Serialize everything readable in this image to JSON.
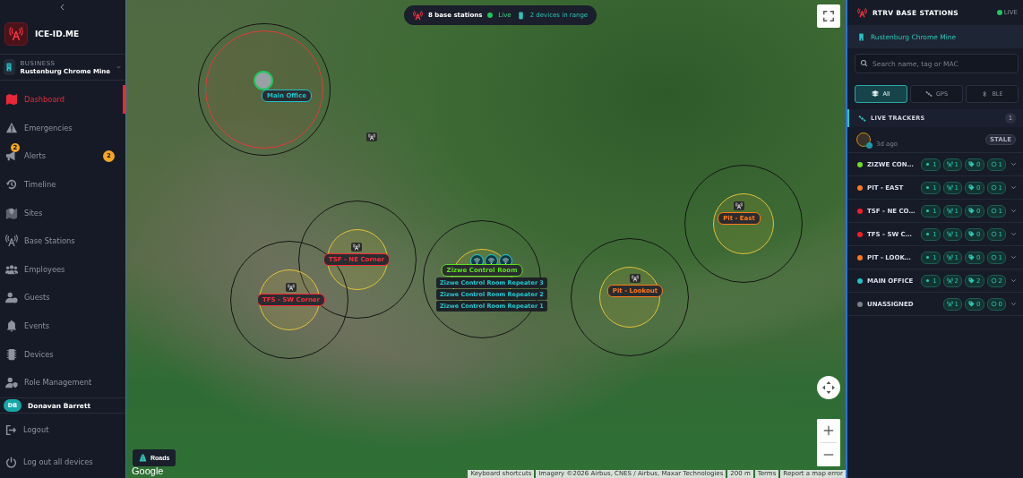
{
  "sidebar": {
    "brand": "ICE-ID.ME",
    "business": {
      "label": "BUSINESS",
      "name": "Rustenburg Chrome Mine"
    },
    "nav": [
      {
        "label": "Dashboard",
        "selected": true
      },
      {
        "label": "Emergencies",
        "selected": false
      },
      {
        "label": "Alerts",
        "selected": false,
        "icon_badge": "2",
        "badge": "2"
      },
      {
        "label": "Timeline",
        "selected": false
      },
      {
        "label": "Sites",
        "selected": false
      },
      {
        "label": "Base Stations",
        "selected": false
      },
      {
        "label": "Employees",
        "selected": false
      },
      {
        "label": "Guests",
        "selected": false
      },
      {
        "label": "Events",
        "selected": false
      },
      {
        "label": "Devices",
        "selected": false
      },
      {
        "label": "Role Management",
        "selected": false
      }
    ],
    "user": {
      "initials": "DB",
      "name": "Donavan Barrett"
    },
    "actions": [
      {
        "label": "Logout"
      },
      {
        "label": "Log out all devices"
      }
    ]
  },
  "map": {
    "status": {
      "stations": "8 base stations",
      "live": "Live",
      "devices": "2 devices in range"
    },
    "stations": [
      {
        "name": "Main Office",
        "color": "#1fc3c9"
      },
      {
        "name": "TSF - NE Corner",
        "color": "#ff2b3a"
      },
      {
        "name": "TFS - SW Corner",
        "color": "#ff2b3a"
      },
      {
        "name": "Zizwe Control Room",
        "color": "#5fe01f"
      },
      {
        "name": "Pit - Lookout",
        "color": "#ff7a1a"
      },
      {
        "name": "Pit - East",
        "color": "#ff7a1a"
      }
    ],
    "repeaters": [
      "Zizwe Control Room Repeater 3",
      "Zizwe Control Room Repeater 2",
      "Zizwe Control Room Repeater 1"
    ],
    "layer_button": "Roads",
    "logo": "Google",
    "attribution": [
      "Keyboard shortcuts",
      "Imagery ©2026 Airbus, CNES / Airbus, Maxar Technologies",
      "200 m",
      "Terms",
      "Report a map error"
    ]
  },
  "panel": {
    "title": "RTRV BASE STATIONS",
    "live": "LIVE",
    "site": "Rustenburg Chrome Mine",
    "search": {
      "placeholder": "Search name, tag or MAC"
    },
    "filters": [
      {
        "label": "All",
        "selected": true
      },
      {
        "label": "GPS",
        "selected": false
      },
      {
        "label": "BLE",
        "selected": false
      }
    ],
    "live_trackers": {
      "title": "LIVE TRACKERS",
      "count": "1",
      "trackers": [
        {
          "time": "3d ago",
          "status": "STALE"
        }
      ]
    },
    "sites": [
      {
        "name": "ZIZWE CON…",
        "color": "#6fe01f",
        "counts": [
          {
            "kind": "tracker",
            "value": "1"
          },
          {
            "kind": "station",
            "value": "1"
          },
          {
            "kind": "tag",
            "value": "0"
          },
          {
            "kind": "zone",
            "value": "1"
          }
        ]
      },
      {
        "name": "PIT - EAST",
        "color": "#ff7a1a",
        "counts": [
          {
            "kind": "tracker",
            "value": "1"
          },
          {
            "kind": "station",
            "value": "1"
          },
          {
            "kind": "tag",
            "value": "0"
          },
          {
            "kind": "zone",
            "value": "1"
          }
        ]
      },
      {
        "name": "TSF - NE CO…",
        "color": "#ff1a2a",
        "counts": [
          {
            "kind": "tracker",
            "value": "1"
          },
          {
            "kind": "station",
            "value": "1"
          },
          {
            "kind": "tag",
            "value": "0"
          },
          {
            "kind": "zone",
            "value": "1"
          }
        ]
      },
      {
        "name": "TFS - SW C…",
        "color": "#ff1a2a",
        "counts": [
          {
            "kind": "tracker",
            "value": "1"
          },
          {
            "kind": "station",
            "value": "1"
          },
          {
            "kind": "tag",
            "value": "0"
          },
          {
            "kind": "zone",
            "value": "1"
          }
        ]
      },
      {
        "name": "PIT - LOOK…",
        "color": "#ff7a1a",
        "counts": [
          {
            "kind": "tracker",
            "value": "1"
          },
          {
            "kind": "station",
            "value": "1"
          },
          {
            "kind": "tag",
            "value": "0"
          },
          {
            "kind": "zone",
            "value": "1"
          }
        ]
      },
      {
        "name": "MAIN OFFICE",
        "color": "#1fc3c9",
        "counts": [
          {
            "kind": "tracker",
            "value": "1"
          },
          {
            "kind": "station",
            "value": "2"
          },
          {
            "kind": "tag",
            "value": "2"
          },
          {
            "kind": "zone",
            "value": "2"
          }
        ]
      },
      {
        "name": "UNASSIGNED",
        "color": "#7a7f88",
        "counts": [
          {
            "kind": "station",
            "value": "1"
          },
          {
            "kind": "tag",
            "value": "0"
          },
          {
            "kind": "zone",
            "value": "0"
          }
        ]
      }
    ]
  }
}
